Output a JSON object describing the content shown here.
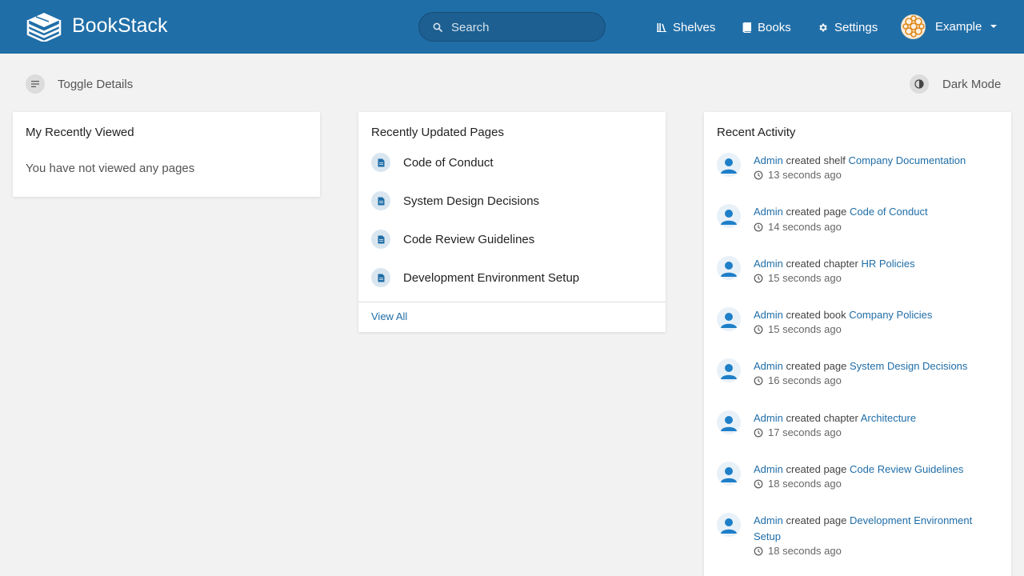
{
  "header": {
    "app_name": "BookStack",
    "search_placeholder": "Search",
    "nav": [
      {
        "label": "Shelves",
        "icon": "shelves-icon"
      },
      {
        "label": "Books",
        "icon": "book-icon"
      },
      {
        "label": "Settings",
        "icon": "gear-icon"
      }
    ],
    "user_name": "Example",
    "colors": {
      "header_bg": "#206ea7",
      "link": "#206ea7"
    }
  },
  "toolbar": {
    "toggle_details": "Toggle Details",
    "dark_mode": "Dark Mode"
  },
  "recently_viewed": {
    "title": "My Recently Viewed",
    "empty_text": "You have not viewed any pages"
  },
  "recently_updated": {
    "title": "Recently Updated Pages",
    "pages": [
      {
        "name": "Code of Conduct"
      },
      {
        "name": "System Design Decisions"
      },
      {
        "name": "Code Review Guidelines"
      },
      {
        "name": "Development Environment Setup"
      }
    ],
    "view_all": "View All"
  },
  "recent_activity": {
    "title": "Recent Activity",
    "items": [
      {
        "user": "Admin",
        "action": "created shelf",
        "target": "Company Documentation",
        "time": "13 seconds ago"
      },
      {
        "user": "Admin",
        "action": "created page",
        "target": "Code of Conduct",
        "time": "14 seconds ago"
      },
      {
        "user": "Admin",
        "action": "created chapter",
        "target": "HR Policies",
        "time": "15 seconds ago"
      },
      {
        "user": "Admin",
        "action": "created book",
        "target": "Company Policies",
        "time": "15 seconds ago"
      },
      {
        "user": "Admin",
        "action": "created page",
        "target": "System Design Decisions",
        "time": "16 seconds ago"
      },
      {
        "user": "Admin",
        "action": "created chapter",
        "target": "Architecture",
        "time": "17 seconds ago"
      },
      {
        "user": "Admin",
        "action": "created page",
        "target": "Code Review Guidelines",
        "time": "18 seconds ago"
      },
      {
        "user": "Admin",
        "action": "created page",
        "target": "Development Environment Setup",
        "time": "18 seconds ago"
      }
    ]
  }
}
